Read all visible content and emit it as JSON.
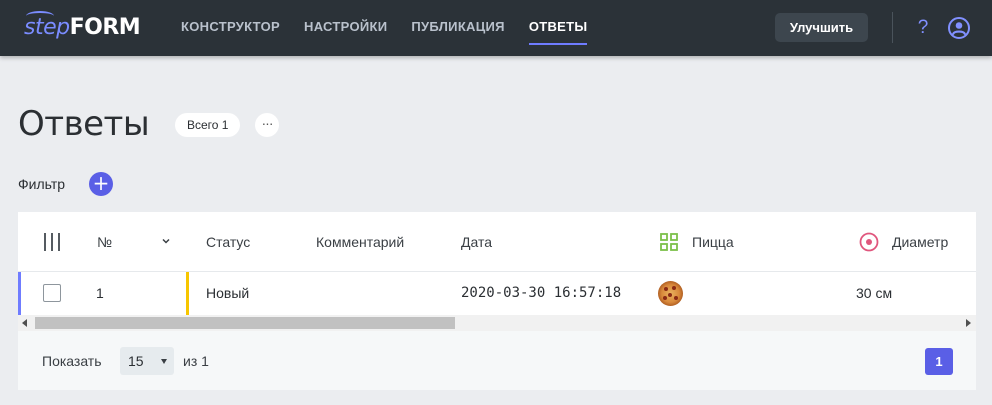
{
  "app": {
    "logo_step": "step",
    "logo_form": "FORM"
  },
  "nav": {
    "items": [
      {
        "label": "КОНСТРУКТОР",
        "active": false
      },
      {
        "label": "НАСТРОЙКИ",
        "active": false
      },
      {
        "label": "ПУБЛИКАЦИЯ",
        "active": false
      },
      {
        "label": "ОТВЕТЫ",
        "active": true
      }
    ],
    "upgrade_label": "Улучшить",
    "help_glyph": "?",
    "icons": {
      "help": "question-mark-icon",
      "user": "user-circle-icon"
    }
  },
  "header": {
    "title": "Ответы",
    "total_badge": "Всего 1",
    "more_glyph": "···"
  },
  "filter": {
    "label": "Фильтр",
    "add_glyph": "+"
  },
  "table": {
    "columns": [
      "№",
      "Статус",
      "Комментарий",
      "Дата",
      "Пицца",
      "Диаметр"
    ],
    "column_icons": {
      "pizza": "grid-icon",
      "diameter": "target-circle-icon"
    },
    "rows": [
      {
        "number": "1",
        "status": "Новый",
        "comment": "",
        "date": "2020-03-30 16:57:18",
        "pizza": "pizza-image",
        "diameter": "30 см"
      }
    ]
  },
  "pagination": {
    "show_label": "Показать",
    "page_size": "15",
    "of_label": "из 1",
    "current_page": "1"
  },
  "colors": {
    "topbar": "#2b3238",
    "accent": "#5a5fe6",
    "status_new": "#f7c600",
    "icon_green": "#7cc04a",
    "icon_pink": "#e0567d"
  }
}
